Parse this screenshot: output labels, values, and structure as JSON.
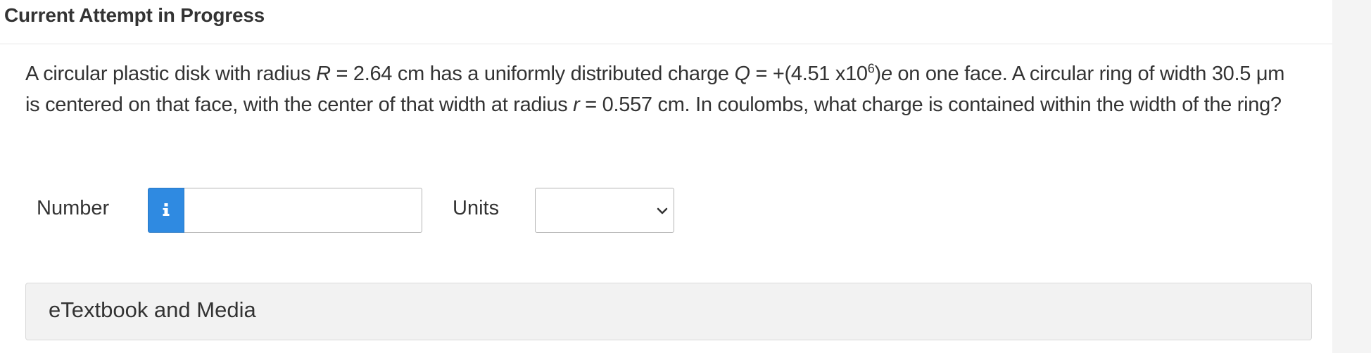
{
  "header": {
    "title": "Current Attempt in Progress"
  },
  "question": {
    "t1": "A circular plastic disk with radius ",
    "var_R": "R",
    "t2": " = 2.64 cm has a uniformly distributed charge ",
    "var_Q": "Q",
    "t3": " = +(4.51 x10",
    "exp": "6",
    "t4": ")",
    "var_e": "e",
    "t5": " on one face. A circular ring of width 30.5 μm is centered on that face, with the center of that width at radius ",
    "var_r": "r",
    "t6": " = 0.557 cm. In coulombs, what charge is contained within the width of the ring?"
  },
  "answer": {
    "number_label": "Number",
    "info_icon": "info-icon",
    "number_value": "",
    "units_label": "Units",
    "units_selected": "",
    "units_icon": "chevron-down-icon"
  },
  "etextbook": {
    "label": "eTextbook and Media"
  },
  "colors": {
    "info_button": "#2f8ae1",
    "text": "#333333",
    "panel_bg": "#f2f2f2"
  }
}
